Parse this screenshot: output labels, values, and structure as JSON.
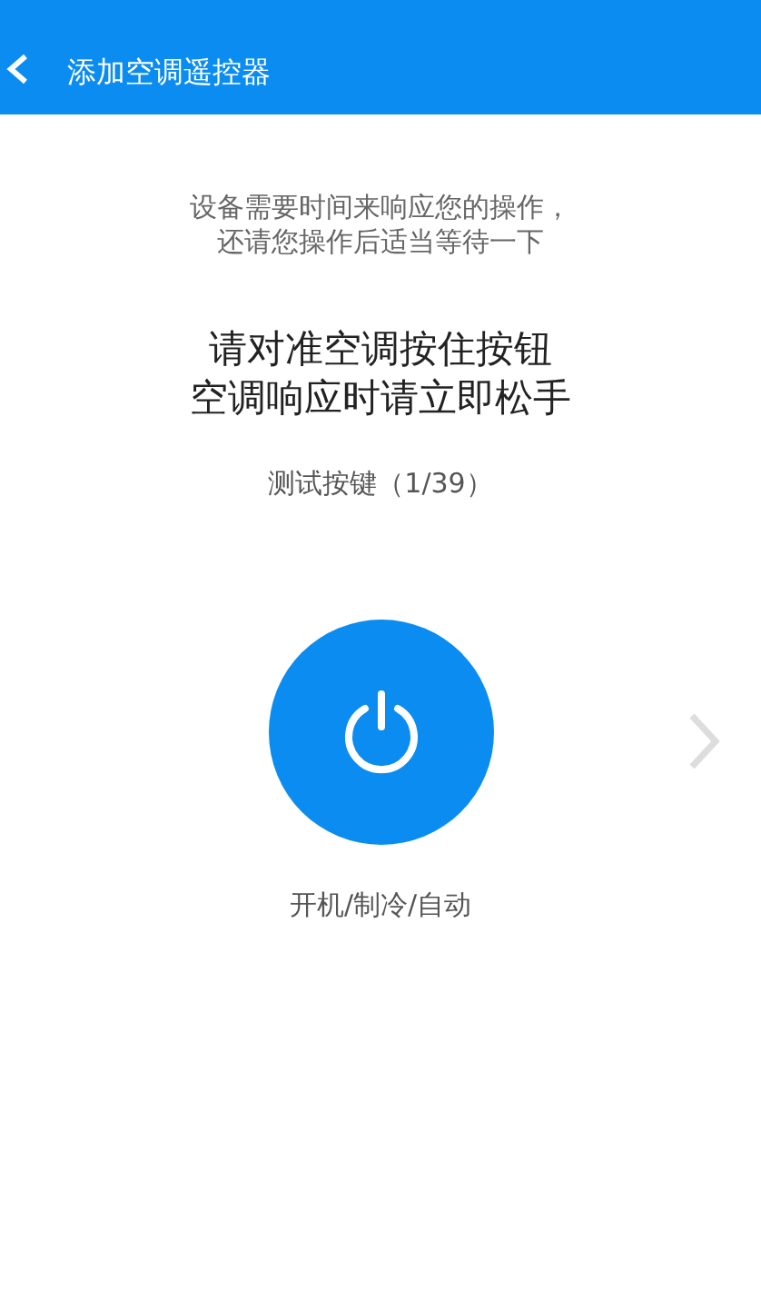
{
  "header": {
    "title": "添加空调遥控器"
  },
  "hint_lines": [
    "设备需要时间来响应您的操作，",
    "还请您操作后适当等待一下"
  ],
  "instruction_lines": [
    "请对准空调按住按钮",
    "空调响应时请立即松手"
  ],
  "progress": "测试按键（1/39）",
  "key_label": "开机/制冷/自动"
}
